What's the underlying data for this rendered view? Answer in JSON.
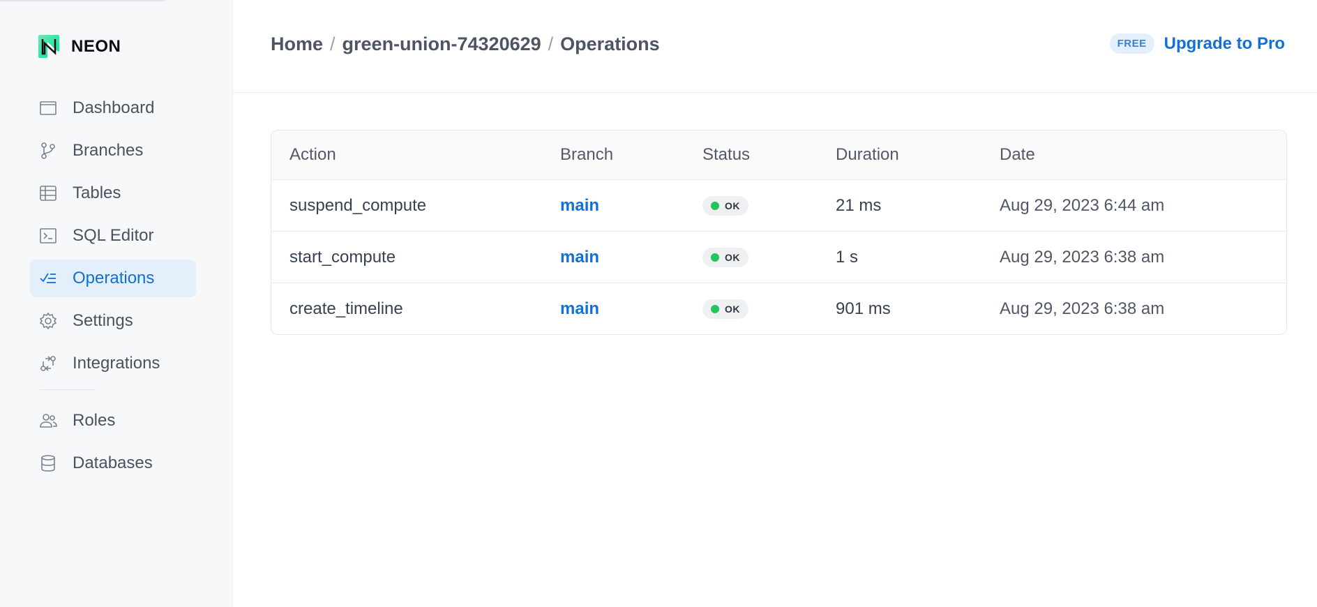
{
  "app": {
    "logo_text": "NEON",
    "brand_color": "#00e599"
  },
  "sidebar": {
    "items": [
      {
        "label": "Dashboard",
        "icon": "dashboard-icon",
        "active": false
      },
      {
        "label": "Branches",
        "icon": "branch-icon",
        "active": false
      },
      {
        "label": "Tables",
        "icon": "table-icon",
        "active": false
      },
      {
        "label": "SQL Editor",
        "icon": "sql-editor-icon",
        "active": false
      },
      {
        "label": "Operations",
        "icon": "operations-icon",
        "active": true
      },
      {
        "label": "Settings",
        "icon": "gear-icon",
        "active": false
      },
      {
        "label": "Integrations",
        "icon": "integrations-icon",
        "active": false
      }
    ],
    "secondary_items": [
      {
        "label": "Roles",
        "icon": "users-icon",
        "active": false
      },
      {
        "label": "Databases",
        "icon": "database-icon",
        "active": false
      }
    ]
  },
  "header": {
    "breadcrumb": [
      "Home",
      "green-union-74320629",
      "Operations"
    ],
    "separator": "/",
    "plan_badge": "FREE",
    "upgrade_label": "Upgrade to Pro"
  },
  "operations_table": {
    "columns": [
      "Action",
      "Branch",
      "Status",
      "Duration",
      "Date"
    ],
    "rows": [
      {
        "action": "suspend_compute",
        "branch": "main",
        "status": "OK",
        "duration": "21 ms",
        "date": "Aug 29, 2023 6:44 am"
      },
      {
        "action": "start_compute",
        "branch": "main",
        "status": "OK",
        "duration": "1 s",
        "date": "Aug 29, 2023 6:38 am"
      },
      {
        "action": "create_timeline",
        "branch": "main",
        "status": "OK",
        "duration": "901 ms",
        "date": "Aug 29, 2023 6:38 am"
      }
    ],
    "status_ok_color": "#22c55e",
    "link_color": "#1370d8"
  }
}
